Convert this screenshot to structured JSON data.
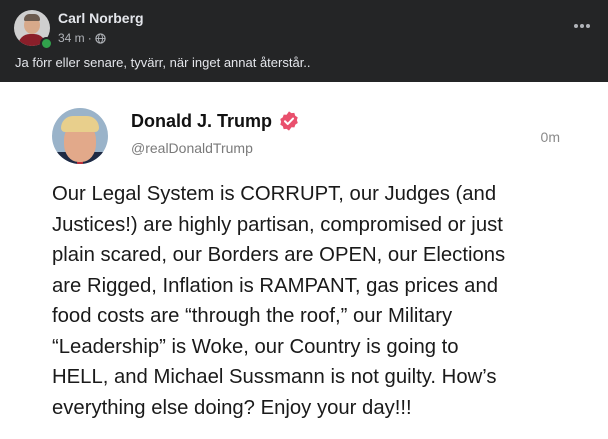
{
  "post": {
    "author": "Carl Norberg",
    "time": "34 m",
    "separator": "·",
    "caption": "Ja förr eller senare, tyvärr, när inget annat återstår..",
    "more_icon": "more-horizontal-icon",
    "privacy_icon": "globe-icon"
  },
  "tweet": {
    "name": "Donald J. Trump",
    "handle": "@realDonaldTrump",
    "time": "0m",
    "verified_color": "#e9506d",
    "lines": [
      "Our Legal System is CORRUPT, our Judges (and",
      "Justices!) are highly partisan, compromised or just",
      "plain scared, our Borders are OPEN, our Elections",
      "are Rigged, Inflation is RAMPANT, gas prices and",
      "food costs are “through the roof,” our Military",
      "“Leadership” is Woke, our Country is going to",
      "HELL, and Michael Sussmann is not guilty. How’s",
      "everything else doing? Enjoy your day!!!"
    ]
  }
}
